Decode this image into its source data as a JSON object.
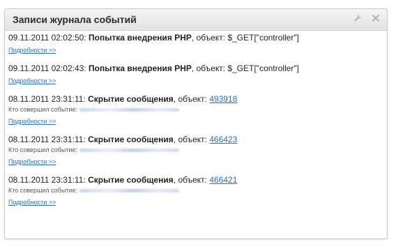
{
  "widget": {
    "title": "Записи журнала событий",
    "tools": [
      {
        "icon": "wrench-icon"
      },
      {
        "icon": "close-icon"
      }
    ]
  },
  "entries": [
    {
      "datetime": "09.11.2011 02:02:50:",
      "action": "Попытка внедрения PHP",
      "object_prefix": ", объект: ",
      "object": "$_GET[\"controller\"]",
      "object_is_link": false,
      "who_label": "",
      "more_label": "Подробности >>"
    },
    {
      "datetime": "09.11.2011 02:02:43:",
      "action": "Попытка внедрения PHP",
      "object_prefix": ", объект: ",
      "object": "$_GET[\"controller\"]",
      "object_is_link": false,
      "who_label": "",
      "more_label": "Подробности >>"
    },
    {
      "datetime": "08.11.2011 23:31:11:",
      "action": "Скрытие сообщения",
      "object_prefix": ", объект: ",
      "object": "493918",
      "object_is_link": true,
      "who_label": "Кто совершил событие:",
      "more_label": "Подробности >>"
    },
    {
      "datetime": "08.11.2011 23:31:11:",
      "action": "Скрытие сообщения",
      "object_prefix": ", объект: ",
      "object": "466423",
      "object_is_link": true,
      "who_label": "Кто совершил событие:",
      "more_label": "Подробности >>"
    },
    {
      "datetime": "08.11.2011 23:31:11:",
      "action": "Скрытие сообщения",
      "object_prefix": ", объект: ",
      "object": "466421",
      "object_is_link": true,
      "who_label": "Кто совершил событие:",
      "more_label": "Подробности >>"
    }
  ],
  "colors": {
    "link": "#2a6eb5",
    "text": "#222222",
    "header_bg": "#ececec"
  }
}
